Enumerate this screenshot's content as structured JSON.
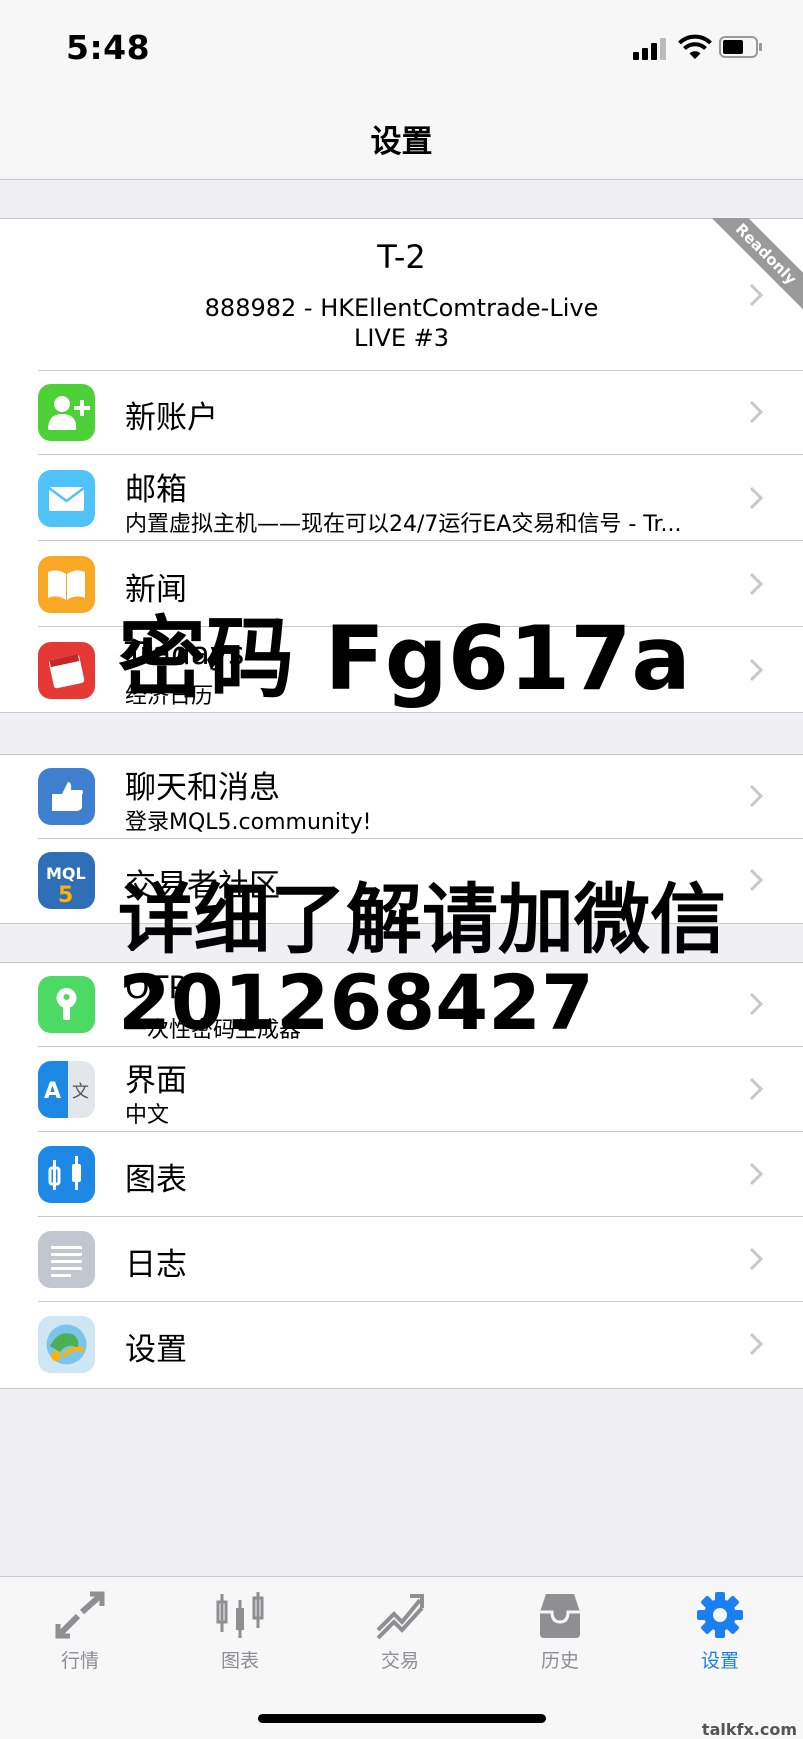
{
  "status": {
    "time": "5:48"
  },
  "nav": {
    "title": "设置"
  },
  "account": {
    "name": "T-2",
    "server": "888982 - HKEllentComtrade-Live",
    "type": "LIVE #3",
    "ribbon": "Readonly"
  },
  "menu": [
    {
      "label": "新账户",
      "icon": "add-account-icon"
    },
    {
      "label": "邮箱",
      "sub": "内置虚拟主机——现在可以24/7运行EA交易和信号 - Tr...",
      "icon": "mail-icon"
    },
    {
      "label": "新闻",
      "icon": "news-icon"
    },
    {
      "label": "Tradays",
      "sub": "经济日历",
      "icon": "calendar-icon"
    },
    {
      "label": "聊天和消息",
      "sub": "登录MQL5.community!",
      "icon": "chat-icon"
    },
    {
      "label": "交易者社区",
      "icon": "mql5-icon"
    },
    {
      "label": "OTP",
      "sub": "一次性密码生成器",
      "icon": "otp-key-icon"
    },
    {
      "label": "界面",
      "sub": "中文",
      "icon": "language-icon"
    },
    {
      "label": "图表",
      "icon": "chart-icon"
    },
    {
      "label": "日志",
      "icon": "journal-icon"
    },
    {
      "label": "设置",
      "icon": "settings-app-icon"
    }
  ],
  "overlay": {
    "password": "密码 Fg617a",
    "wechat": "详细了解请加微信",
    "number": "201268427"
  },
  "tabs": [
    {
      "label": "行情",
      "icon": "quotes-icon"
    },
    {
      "label": "图表",
      "icon": "charts-icon"
    },
    {
      "label": "交易",
      "icon": "trade-icon"
    },
    {
      "label": "历史",
      "icon": "history-icon"
    },
    {
      "label": "设置",
      "icon": "settings-gear-icon",
      "active": true
    }
  ],
  "watermark": "talkfx.com",
  "colors": {
    "accent": "#1a7ff0",
    "inactive": "#8e8e93",
    "ribbon": "#9a9a9a"
  }
}
